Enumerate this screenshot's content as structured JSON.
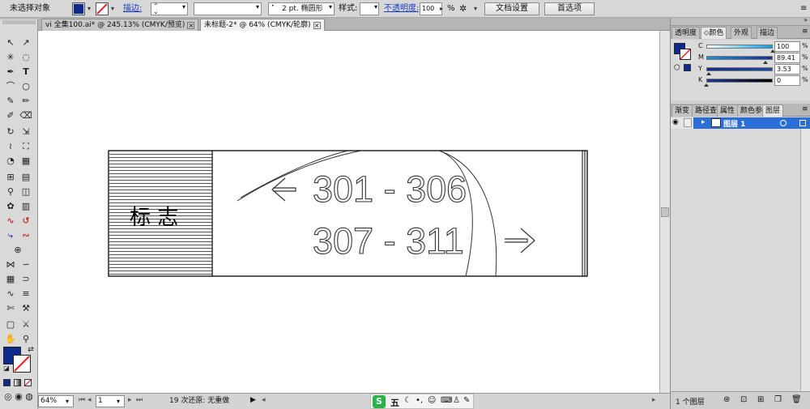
{
  "control_bar": {
    "selection_status": "未选择对象",
    "stroke_label": "描边:",
    "brush_value": "2 pt. 椭圆形",
    "style_label": "样式:",
    "opacity_label": "不透明度:",
    "opacity_value": "100",
    "opacity_unit": "%",
    "doc_setup_button": "文档设置",
    "preferences_button": "首选项",
    "fill_color": "#0e2a8c"
  },
  "doc_tabs": [
    {
      "label": "vi 全集100.ai* @ 245.13% (CMYK/预览)"
    },
    {
      "label": "未标题-2* @ 64% (CMYK/轮廓)"
    }
  ],
  "artwork": {
    "label": "标 志",
    "line1": "301 - 306",
    "line2": "307 - 311"
  },
  "status_bar": {
    "zoom": "64%",
    "artboard": "1",
    "undo_status": "19 次还原: 无重做"
  },
  "ime": {
    "label": "五"
  },
  "color_panel": {
    "tabs": [
      "透明度",
      "颜色",
      "外观",
      "描边"
    ],
    "active_tab": 1,
    "sliders": [
      {
        "label": "C",
        "value": "100",
        "pct": 1.0,
        "gradient": "linear-gradient(90deg,#ffffff,#00a0e9)"
      },
      {
        "label": "M",
        "value": "89.41",
        "pct": 0.894,
        "gradient": "linear-gradient(90deg,#1e8fd5,#1a2f8f)"
      },
      {
        "label": "Y",
        "value": "3.53",
        "pct": 0.035,
        "gradient": "linear-gradient(90deg,#0f2f8e,#1f4aa0)"
      },
      {
        "label": "K",
        "value": "0",
        "pct": 0.0,
        "gradient": "linear-gradient(90deg,#1a3a9a,#000000)"
      }
    ],
    "unit": "%",
    "fill_color": "#0e2a8c"
  },
  "layers_panel": {
    "tabs": [
      "渐变",
      "路径查",
      "属性",
      "颜色参",
      "图层"
    ],
    "active_tab": 4,
    "layer_name": "图层 1",
    "layer_count": "1 个图层",
    "highlight_color": "#2a6fd8"
  }
}
